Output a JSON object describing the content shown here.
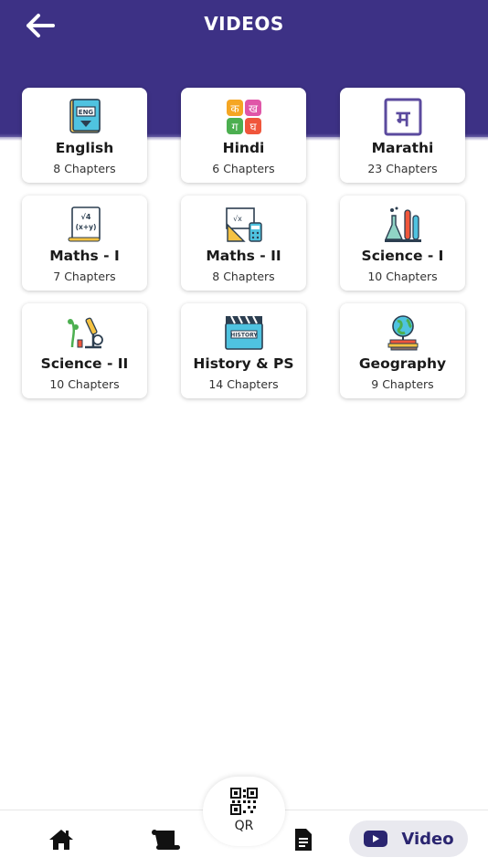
{
  "header": {
    "title": "VIDEOS",
    "back_icon": "arrow-left-icon"
  },
  "colors": {
    "header_bg": "#3d3185",
    "accent": "#2a2570"
  },
  "subjects": [
    {
      "name": "English",
      "count": "8 Chapters",
      "icon": "english-book-icon"
    },
    {
      "name": "Hindi",
      "count": "6 Chapters",
      "icon": "hindi-letters-icon"
    },
    {
      "name": "Marathi",
      "count": "23 Chapters",
      "icon": "marathi-letter-icon"
    },
    {
      "name": "Maths - I",
      "count": "7 Chapters",
      "icon": "maths-formula-icon"
    },
    {
      "name": "Maths - II",
      "count": "8 Chapters",
      "icon": "geometry-tools-icon"
    },
    {
      "name": "Science - I",
      "count": "10 Chapters",
      "icon": "chemistry-flasks-icon"
    },
    {
      "name": "Science - II",
      "count": "10 Chapters",
      "icon": "microscope-plant-icon"
    },
    {
      "name": "History & PS",
      "count": "14 Chapters",
      "icon": "history-clapboard-icon"
    },
    {
      "name": "Geography",
      "count": "9 Chapters",
      "icon": "globe-books-icon"
    }
  ],
  "bottom_nav": {
    "home_icon": "home-icon",
    "scroll_icon": "scroll-icon",
    "qr_label": "QR",
    "document_icon": "document-icon",
    "video_label": "Video",
    "video_icon": "video-play-icon"
  }
}
